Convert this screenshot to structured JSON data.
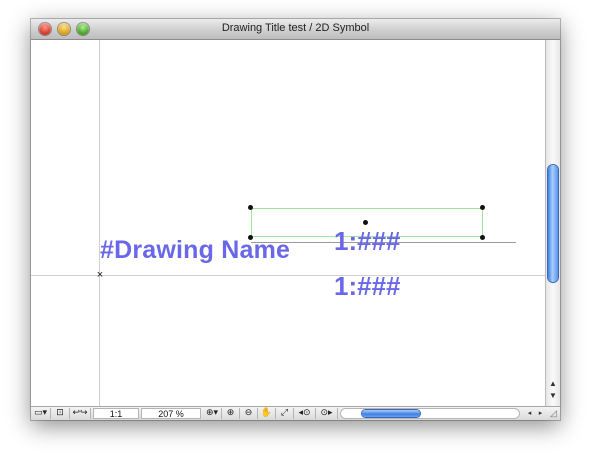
{
  "window": {
    "title": "Drawing Title test / 2D Symbol",
    "traffic_lights": {
      "close": "close",
      "minimize": "minimize",
      "zoom": "zoom"
    }
  },
  "canvas": {
    "drawing_name": "#Drawing Name",
    "scale_label_1": "1:###",
    "scale_label_2": "1:###",
    "origin_marker": "×",
    "text_color": "#6a67e8",
    "guide_color": "#cfcfcf",
    "selection_color": "#9fe39f"
  },
  "statusbar": {
    "tools": [
      {
        "icon": "layer-settings-icon",
        "glyph": "▭▾"
      },
      {
        "icon": "zoom-window-icon",
        "glyph": "⊡"
      },
      {
        "icon": "undo-redo-view-icon",
        "glyph": "↩↪"
      }
    ],
    "scale_value": "1:1",
    "zoom_value": "207 %",
    "zoom_tools": [
      {
        "icon": "zoom-dropdown-icon",
        "glyph": "⊕▾"
      },
      {
        "icon": "zoom-in-icon",
        "glyph": "⊕"
      },
      {
        "icon": "zoom-out-icon",
        "glyph": "⊖"
      },
      {
        "icon": "pan-hand-icon",
        "glyph": "✋"
      },
      {
        "icon": "fit-in-window-icon",
        "glyph": "⤢"
      },
      {
        "icon": "previous-zoom-icon",
        "glyph": "◂⊙"
      },
      {
        "icon": "next-zoom-icon",
        "glyph": "⊙▸"
      }
    ],
    "hscroll_left": "◂",
    "hscroll_right": "▸",
    "resize_grip": "◿"
  },
  "vertical_scroll": {
    "up": "▲",
    "down": "▼"
  }
}
